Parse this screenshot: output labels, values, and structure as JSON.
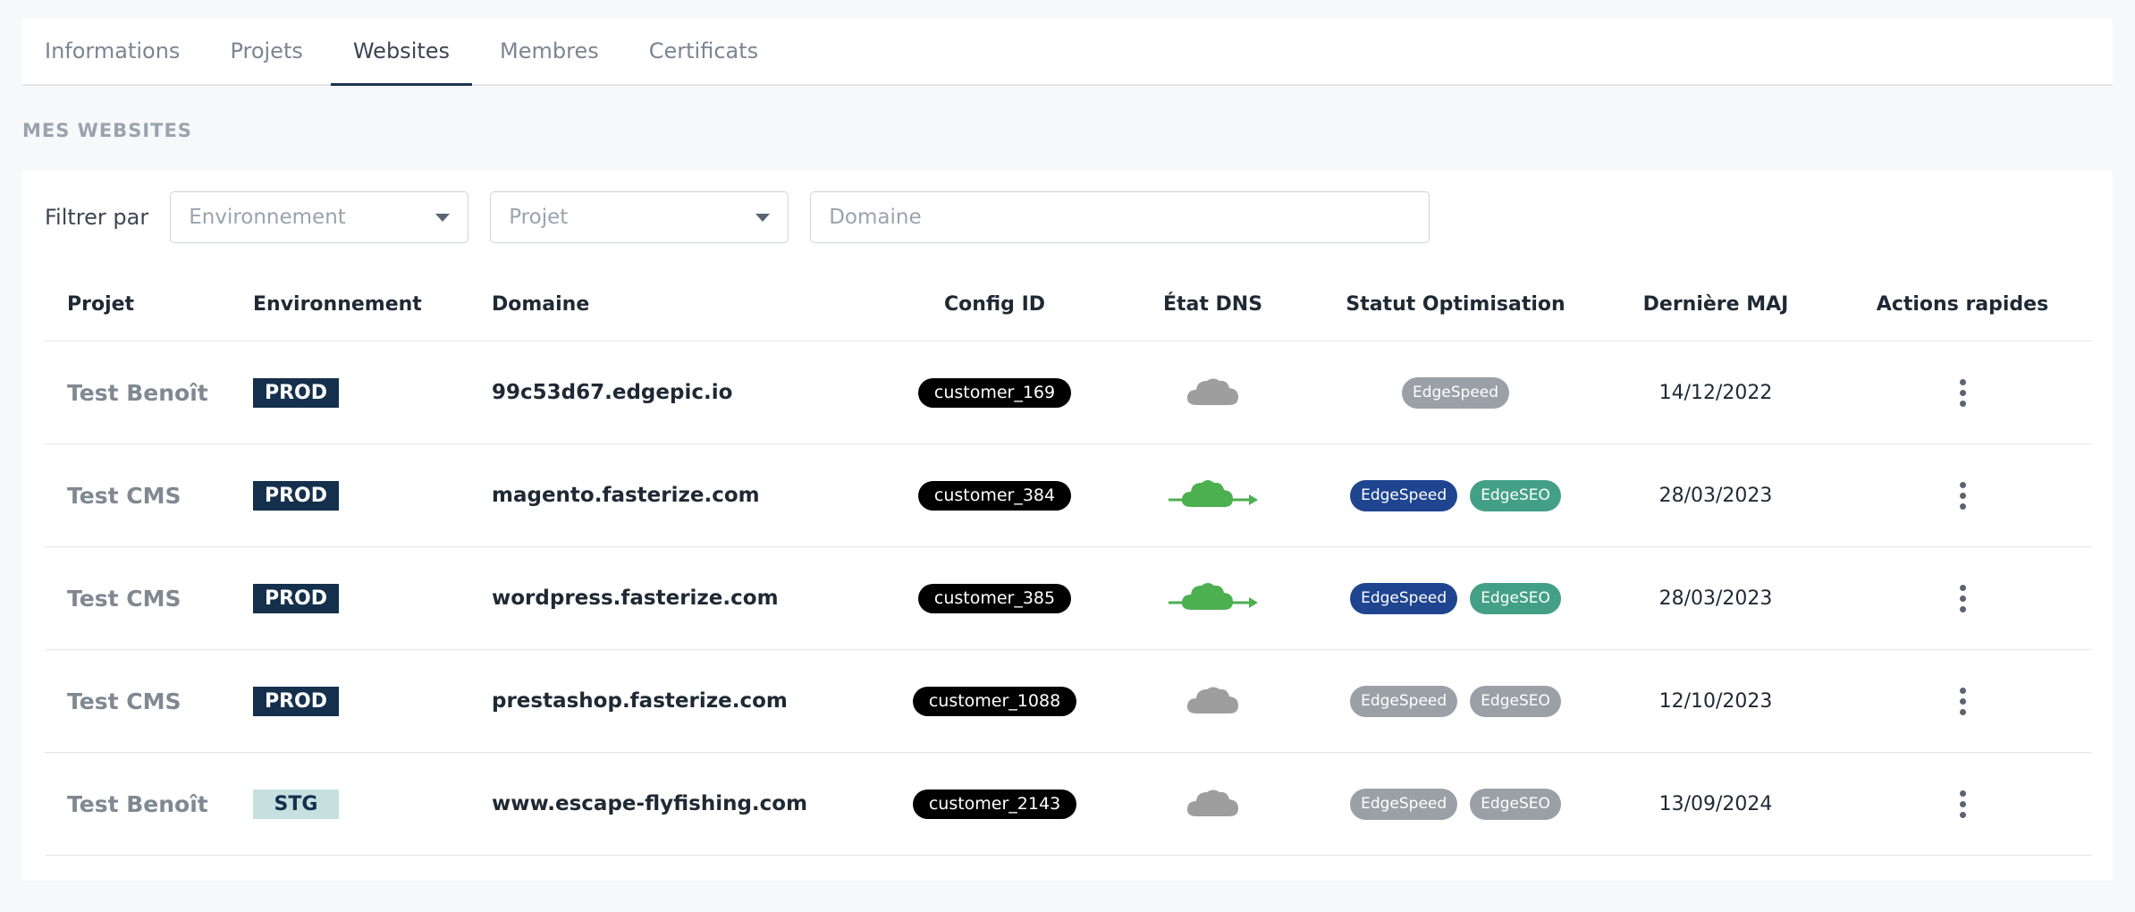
{
  "tabs": [
    {
      "label": "Informations",
      "active": false
    },
    {
      "label": "Projets",
      "active": false
    },
    {
      "label": "Websites",
      "active": true
    },
    {
      "label": "Membres",
      "active": false
    },
    {
      "label": "Certificats",
      "active": false
    }
  ],
  "section_title": "MES WEBSITES",
  "filters": {
    "label": "Filtrer par",
    "environnement_placeholder": "Environnement",
    "projet_placeholder": "Projet",
    "domaine_placeholder": "Domaine"
  },
  "table": {
    "headers": {
      "projet": "Projet",
      "environnement": "Environnement",
      "domaine": "Domaine",
      "config_id": "Config ID",
      "etat_dns": "État DNS",
      "statut_optimisation": "Statut Optimisation",
      "derniere_maj": "Dernière MAJ",
      "actions": "Actions rapides"
    },
    "rows": [
      {
        "projet": "Test Benoît",
        "env": "PROD",
        "domaine": "99c53d67.edgepic.io",
        "config_id": "customer_169",
        "dns": "inactive",
        "badges": [
          {
            "label": "EdgeSpeed",
            "color": "#9aa0a6"
          }
        ],
        "maj": "14/12/2022"
      },
      {
        "projet": "Test CMS",
        "env": "PROD",
        "domaine": "magento.fasterize.com",
        "config_id": "customer_384",
        "dns": "active",
        "badges": [
          {
            "label": "EdgeSpeed",
            "color": "#1f4591"
          },
          {
            "label": "EdgeSEO",
            "color": "#43a087"
          }
        ],
        "maj": "28/03/2023"
      },
      {
        "projet": "Test CMS",
        "env": "PROD",
        "domaine": "wordpress.fasterize.com",
        "config_id": "customer_385",
        "dns": "active",
        "badges": [
          {
            "label": "EdgeSpeed",
            "color": "#1f4591"
          },
          {
            "label": "EdgeSEO",
            "color": "#43a087"
          }
        ],
        "maj": "28/03/2023"
      },
      {
        "projet": "Test CMS",
        "env": "PROD",
        "domaine": "prestashop.fasterize.com",
        "config_id": "customer_1088",
        "dns": "inactive",
        "badges": [
          {
            "label": "EdgeSpeed",
            "color": "#9aa0a6"
          },
          {
            "label": "EdgeSEO",
            "color": "#9aa0a6"
          }
        ],
        "maj": "12/10/2023"
      },
      {
        "projet": "Test Benoît",
        "env": "STG",
        "domaine": "www.escape-flyfishing.com",
        "config_id": "customer_2143",
        "dns": "inactive",
        "badges": [
          {
            "label": "EdgeSpeed",
            "color": "#9aa0a6"
          },
          {
            "label": "EdgeSEO",
            "color": "#9aa0a6"
          }
        ],
        "maj": "13/09/2024"
      }
    ]
  },
  "colors": {
    "dns_active": "#4caf50",
    "dns_inactive": "#9e9e9e",
    "env_prod_bg": "#14304d",
    "env_stg_bg": "#c6e0e0"
  },
  "icons": {
    "dns_active": "cloud-arrow-icon",
    "dns_inactive": "cloud-icon",
    "actions": "kebab-menu-icon",
    "select_caret": "caret-down-icon"
  }
}
